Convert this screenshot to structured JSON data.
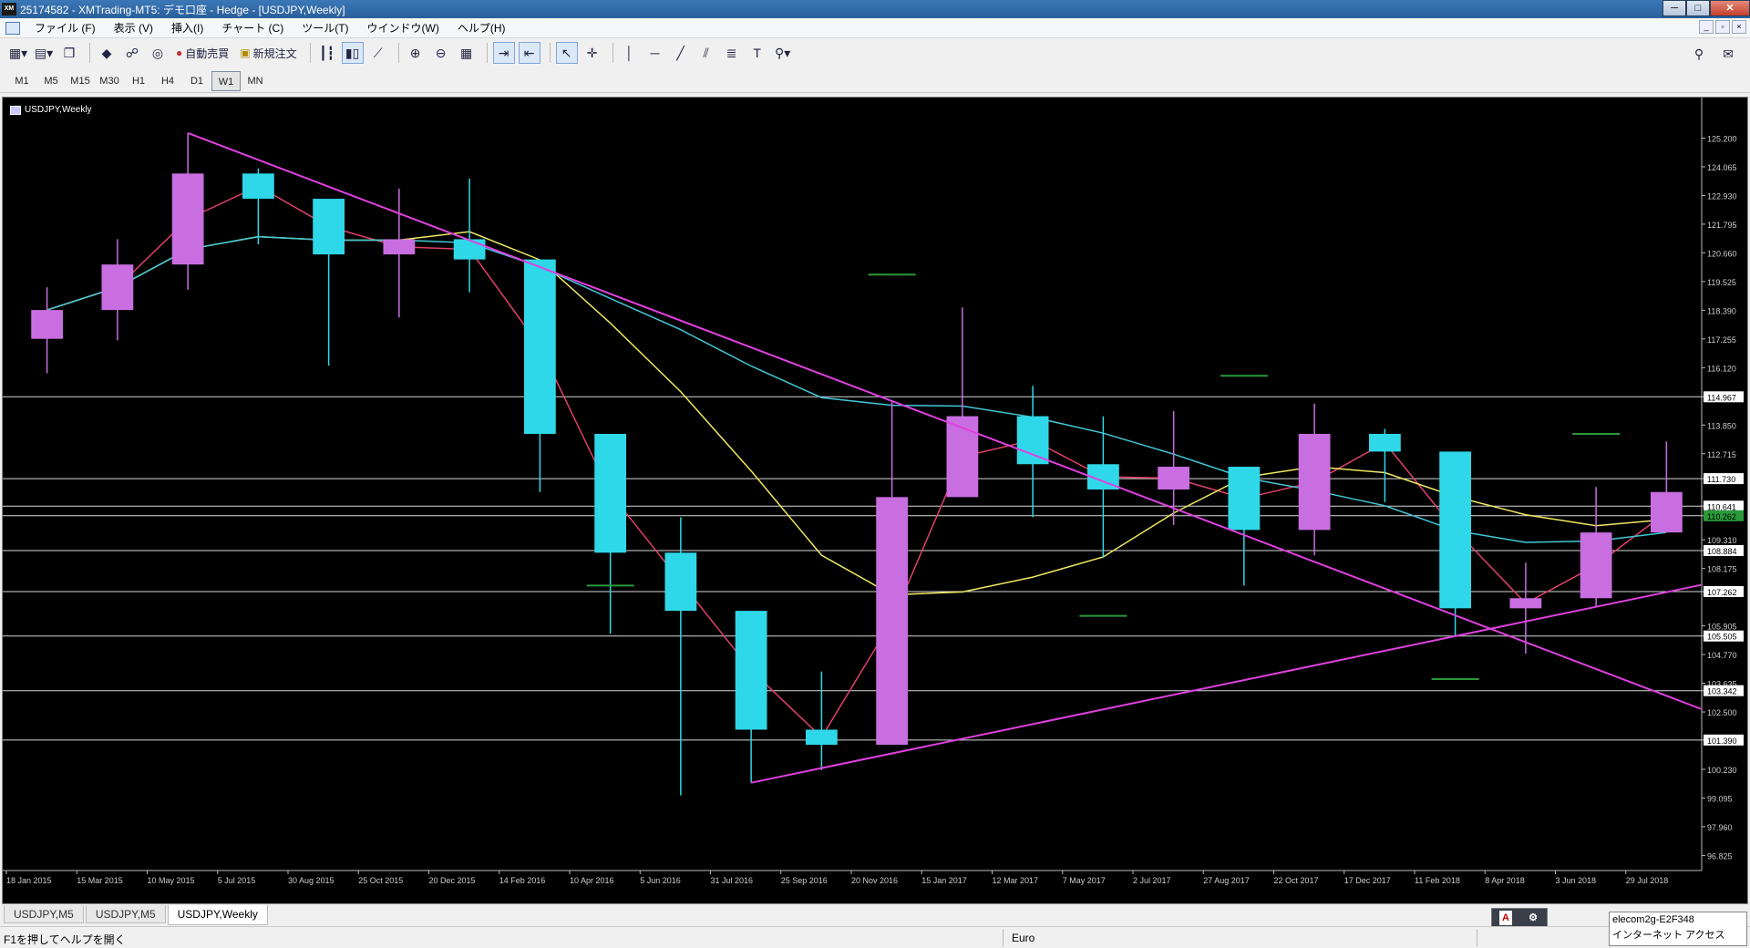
{
  "window": {
    "title": "25174582 - XMTrading-MT5: デモ口座 - Hedge - [USDJPY,Weekly]",
    "app_icon": "XM",
    "buttons": {
      "minimize": "─",
      "maximize": "□",
      "close": "✕"
    }
  },
  "menu": {
    "items": [
      "ファイル (F)",
      "表示 (V)",
      "挿入(I)",
      "チャート (C)",
      "ツール(T)",
      "ウインドウ(W)",
      "ヘルプ(H)"
    ],
    "mdi_buttons": [
      "_",
      "▫",
      "×"
    ]
  },
  "toolbar": {
    "auto_trade_label": "自動売買",
    "new_order_label": "新規注文"
  },
  "timeframes": {
    "items": [
      "M1",
      "M5",
      "M15",
      "M30",
      "H1",
      "H4",
      "D1",
      "W1",
      "MN"
    ],
    "active": "W1"
  },
  "chart": {
    "symbol_label": "USDJPY,Weekly",
    "price_ticks": [
      "125.200",
      "124.065",
      "122.930",
      "121.795",
      "120.660",
      "119.525",
      "118.390",
      "117.255",
      "116.120",
      "114.967",
      "113.850",
      "112.715",
      "111.730",
      "110.641",
      "110.262",
      "109.310",
      "108.884",
      "108.175",
      "107.262",
      "105.905",
      "105.505",
      "104.770",
      "103.635",
      "103.342",
      "102.500",
      "101.390",
      "100.230",
      "99.095",
      "97.960",
      "96.825"
    ],
    "highlighted_levels": [
      "114.967",
      "111.730",
      "110.641",
      "110.262",
      "108.884",
      "107.262",
      "105.505",
      "103.342",
      "101.390"
    ],
    "date_labels": [
      "18 Jan 2015",
      "15 Mar 2015",
      "10 May 2015",
      "5 Jul 2015",
      "30 Aug 2015",
      "25 Oct 2015",
      "20 Dec 2015",
      "14 Feb 2016",
      "10 Apr 2016",
      "5 Jun 2016",
      "31 Jul 2016",
      "25 Sep 2016",
      "20 Nov 2016",
      "15 Jan 2017",
      "12 Mar 2017",
      "7 May 2017",
      "2 Jul 2017",
      "27 Aug 2017",
      "22 Oct 2017",
      "17 Dec 2017",
      "11 Feb 2018",
      "8 Apr 2018",
      "3 Jun 2018",
      "29 Jul 2018"
    ],
    "colors": {
      "background": "#000000",
      "bull_candle": "#c86ee0",
      "bear_candle": "#2fd8e8",
      "trendline": "#e040e0",
      "ma_fast": "#e0406a",
      "ma_slow": "#f0e860",
      "ma_long": "#40c8d8",
      "level_line": "#d8d8d8",
      "marker": "#2a9a3a"
    }
  },
  "chart_data": {
    "type": "candlestick",
    "title": "USDJPY,Weekly",
    "ylim": [
      96.3,
      126.3
    ],
    "x": [
      "18 Jan 2015",
      "15 Mar 2015",
      "10 May 2015",
      "5 Jul 2015",
      "30 Aug 2015",
      "25 Oct 2015",
      "20 Dec 2015",
      "14 Feb 2016",
      "10 Apr 2016",
      "5 Jun 2016",
      "31 Jul 2016",
      "25 Sep 2016",
      "20 Nov 2016",
      "15 Jan 2017",
      "12 Mar 2017",
      "7 May 2017",
      "2 Jul 2017",
      "27 Aug 2017",
      "22 Oct 2017",
      "17 Dec 2017",
      "11 Feb 2018",
      "8 Apr 2018",
      "3 Jun 2018",
      "29 Jul 2018"
    ],
    "close": [
      118.4,
      120.2,
      123.8,
      122.8,
      120.6,
      121.2,
      120.4,
      113.5,
      108.8,
      106.5,
      101.8,
      101.2,
      111.0,
      114.2,
      112.3,
      111.3,
      112.2,
      109.7,
      113.5,
      112.8,
      106.6,
      107.0,
      109.6,
      111.2
    ],
    "high": [
      119.3,
      121.2,
      125.4,
      124.0,
      121.7,
      123.2,
      123.6,
      117.1,
      111.9,
      110.2,
      104.2,
      104.1,
      114.8,
      118.5,
      115.4,
      114.2,
      114.4,
      111.1,
      114.7,
      113.7,
      110.5,
      108.4,
      111.4,
      113.2
    ],
    "low": [
      115.9,
      117.2,
      119.2,
      121.0,
      116.2,
      118.1,
      119.1,
      111.2,
      105.6,
      99.2,
      99.7,
      100.2,
      101.9,
      111.8,
      110.2,
      108.6,
      109.9,
      107.5,
      108.7,
      110.8,
      105.5,
      104.8,
      106.7,
      109.8
    ],
    "levels": [
      114.967,
      111.73,
      110.641,
      110.262,
      108.884,
      107.262,
      105.505,
      103.342,
      101.39
    ]
  },
  "tabs": [
    "USDJPY,M5",
    "USDJPY,M5",
    "USDJPY,Weekly"
  ],
  "active_tab": "USDJPY,Weekly",
  "status": {
    "help": "F1を押してヘルプを開く",
    "profile": "Euro",
    "ime_line1": "elecom2g-E2F348",
    "ime_line2": "インターネット アクセス"
  }
}
